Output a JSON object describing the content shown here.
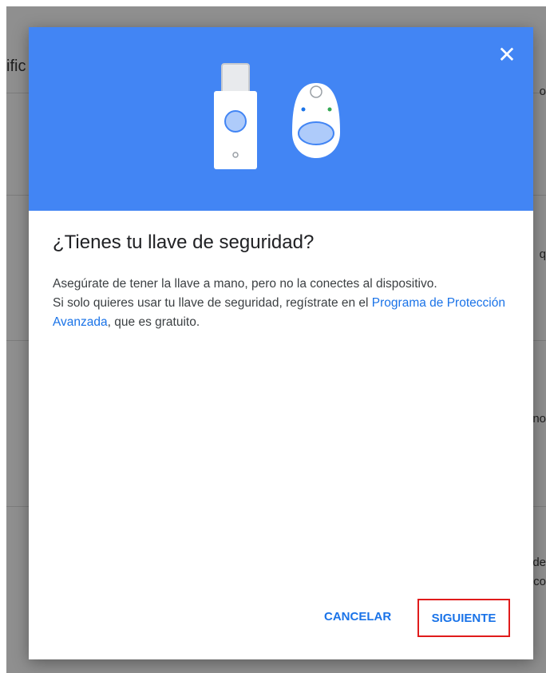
{
  "background": {
    "title_fragment": "ific",
    "right_fragments": [
      "o",
      "q",
      "no",
      "de",
      "co"
    ]
  },
  "dialog": {
    "close_icon": "close-icon",
    "title": "¿Tienes tu llave de seguridad?",
    "paragraph1": "Asegúrate de tener la llave a mano, pero no la conectes al dispositivo.",
    "paragraph2_prefix": "Si solo quieres usar tu llave de seguridad, regístrate en el ",
    "paragraph2_link": "Programa de Protección Avanzada",
    "paragraph2_suffix": ", que es gratuito.",
    "cancel_label": "CANCELAR",
    "next_label": "SIGUIENTE"
  },
  "colors": {
    "hero": "#4285f4",
    "accent": "#1a73e8",
    "highlight": "#e01b1b",
    "overlay": "#8f8f8f"
  }
}
